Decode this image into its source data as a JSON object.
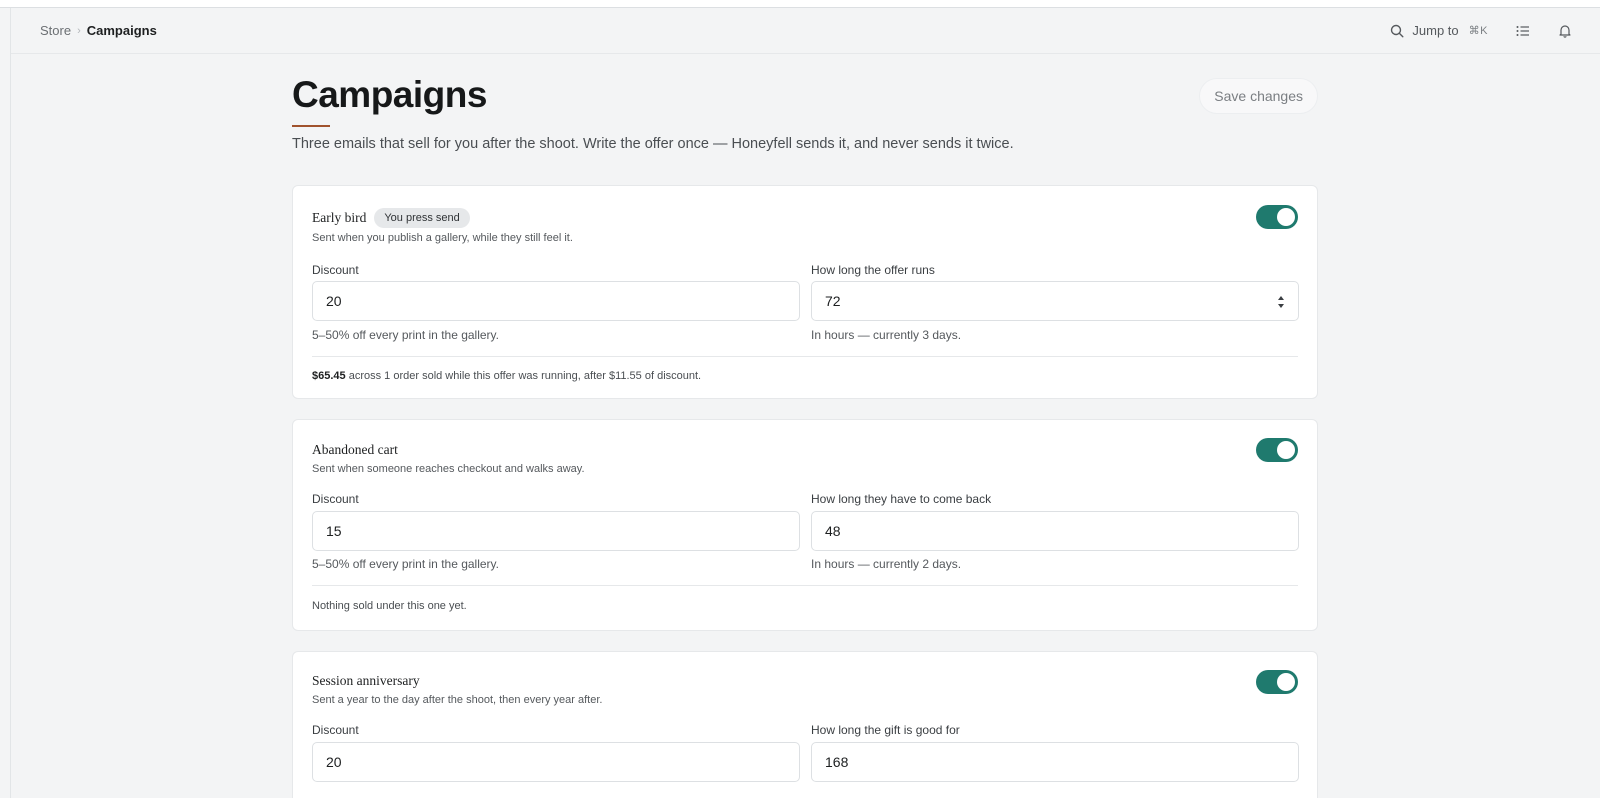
{
  "breadcrumb": {
    "store": "Store",
    "current": "Campaigns"
  },
  "topbar": {
    "jump_label": "Jump to",
    "jump_shortcut": "⌘K"
  },
  "page": {
    "title": "Campaigns",
    "subtitle": "Three emails that sell for you after the shoot. Write the offer once — Honeyfell sends it, and never sends it twice.",
    "save_label": "Save changes"
  },
  "campaigns": [
    {
      "name": "Early bird",
      "badge": "You press send",
      "description": "Sent when you publish a gallery, while they still feel it.",
      "enabled": true,
      "discount_label": "Discount",
      "discount_value": "20",
      "discount_help": "5–50% off every print in the gallery.",
      "duration_label": "How long the offer runs",
      "duration_value": "72",
      "duration_help": "In hours — currently 3 days.",
      "result_amount": "$65.45",
      "result_text": " across 1 order sold while this offer was running, after $11.55 of discount."
    },
    {
      "name": "Abandoned cart",
      "description": "Sent when someone reaches checkout and walks away.",
      "enabled": true,
      "discount_label": "Discount",
      "discount_value": "15",
      "discount_help": "5–50% off every print in the gallery.",
      "duration_label": "How long they have to come back",
      "duration_value": "48",
      "duration_help": "In hours — currently 2 days.",
      "result_text": "Nothing sold under this one yet."
    },
    {
      "name": "Session anniversary",
      "description": "Sent a year to the day after the shoot, then every year after.",
      "enabled": true,
      "discount_label": "Discount",
      "discount_value": "20",
      "duration_label": "How long the gift is good for",
      "duration_value": "168"
    }
  ],
  "colors": {
    "accent": "#1f7a6e",
    "title_underline": "#a0522d",
    "background": "#f3f4f5"
  },
  "icons": [
    "search-icon",
    "list-icon",
    "bell-icon",
    "stepper-icon"
  ]
}
